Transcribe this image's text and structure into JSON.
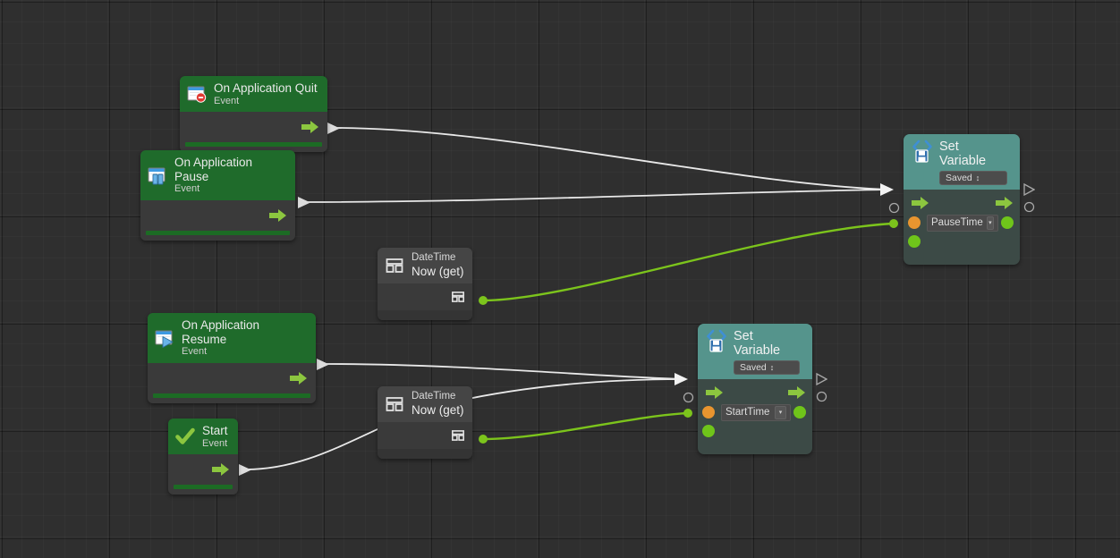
{
  "app": {
    "name": "visual-scripting-graph-canvas",
    "theme": "dark"
  },
  "colors": {
    "canvas_bg": "#2f2f2f",
    "event_header": "#1f6b2b",
    "node_body": "#3a3a3a",
    "setvar_header": "#55948c",
    "setvar_body": "#3c4a46",
    "flow_wire": "#e8e8e8",
    "value_wire": "#7cc41c",
    "port_green": "#6fc51a",
    "port_orange": "#e8952f",
    "arrow_green": "#8cc63f"
  },
  "nodes": [
    {
      "id": "on-application-quit",
      "kind": "event",
      "title": "On Application Quit",
      "subtitle": "Event",
      "icon": "window-quit-icon",
      "ports": {
        "flow_out": "flow-output-port"
      }
    },
    {
      "id": "on-application-pause",
      "kind": "event",
      "title": "On Application Pause",
      "subtitle": "Event",
      "icon": "window-pause-icon",
      "ports": {
        "flow_out": "flow-output-port"
      }
    },
    {
      "id": "on-application-resume",
      "kind": "event",
      "title": "On Application Resume",
      "subtitle": "Event",
      "icon": "window-resume-icon",
      "ports": {
        "flow_out": "flow-output-port"
      }
    },
    {
      "id": "start",
      "kind": "event",
      "title": "Start",
      "subtitle": "Event",
      "icon": "checkmark-icon",
      "ports": {
        "flow_out": "flow-output-port"
      }
    },
    {
      "id": "datetime-now-top",
      "kind": "value",
      "type_label": "DateTime",
      "member_label": "Now (get)",
      "icon": "struct-icon",
      "ports": {
        "value_out": "value-output-port"
      }
    },
    {
      "id": "datetime-now-bottom",
      "kind": "value",
      "type_label": "DateTime",
      "member_label": "Now (get)",
      "icon": "struct-icon",
      "ports": {
        "value_out": "value-output-port"
      }
    },
    {
      "id": "set-variable-pausetime",
      "kind": "setvar",
      "title": "Set Variable",
      "scope_label": "Saved",
      "scope_arrows": "↕",
      "icon": "code-brackets-save-icon",
      "variable_name": "PauseTime",
      "dropdown_glyph": "▾"
    },
    {
      "id": "set-variable-starttime",
      "kind": "setvar",
      "title": "Set Variable",
      "scope_label": "Saved",
      "scope_arrows": "↕",
      "icon": "code-brackets-save-icon",
      "variable_name": "StartTime",
      "dropdown_glyph": "▾"
    }
  ],
  "connections": [
    {
      "from": "on-application-quit.flow_out",
      "to": "set-variable-pausetime.flow_in",
      "kind": "flow"
    },
    {
      "from": "on-application-pause.flow_out",
      "to": "set-variable-pausetime.flow_in",
      "kind": "flow"
    },
    {
      "from": "datetime-now-top.value_out",
      "to": "set-variable-pausetime.value_in",
      "kind": "value"
    },
    {
      "from": "on-application-resume.flow_out",
      "to": "set-variable-starttime.flow_in",
      "kind": "flow"
    },
    {
      "from": "start.flow_out",
      "to": "set-variable-starttime.flow_in",
      "kind": "flow"
    },
    {
      "from": "datetime-now-bottom.value_out",
      "to": "set-variable-starttime.value_in",
      "kind": "value"
    }
  ]
}
